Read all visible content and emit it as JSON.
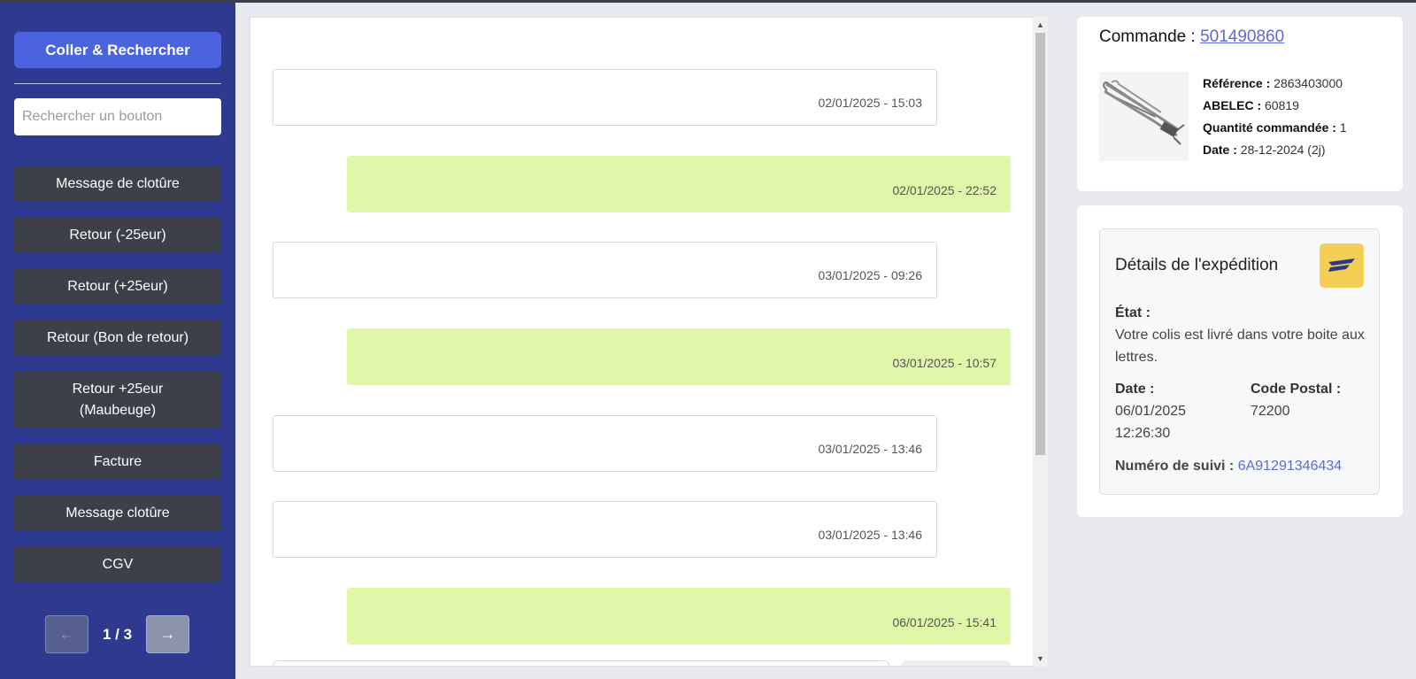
{
  "sidebar": {
    "primary_button": "Coller & Rechercher",
    "search_placeholder": "Rechercher un bouton",
    "buttons": [
      {
        "label": "Message de clotûre"
      },
      {
        "label": "Retour (-25eur)"
      },
      {
        "label": "Retour (+25eur)"
      },
      {
        "label": "Retour (Bon de retour)"
      },
      {
        "label": "Retour +25eur (Maubeuge)"
      },
      {
        "label": "Facture"
      },
      {
        "label": "Message clotûre"
      },
      {
        "label": "CGV"
      }
    ],
    "pager": {
      "prev": "←",
      "label": "1 / 3",
      "next": "→"
    }
  },
  "conversation": {
    "messages": [
      {
        "direction": "in",
        "timestamp": "02/01/2025 - 15:03"
      },
      {
        "direction": "out",
        "timestamp": "02/01/2025 - 22:52"
      },
      {
        "direction": "in",
        "timestamp": "03/01/2025 - 09:26"
      },
      {
        "direction": "out",
        "timestamp": "03/01/2025 - 10:57"
      },
      {
        "direction": "in",
        "timestamp": "03/01/2025 - 13:46"
      },
      {
        "direction": "in",
        "timestamp": "03/01/2025 - 13:46"
      },
      {
        "direction": "out",
        "timestamp": "06/01/2025 - 15:41"
      }
    ]
  },
  "order": {
    "title_label": "Commande :",
    "number": "501490860",
    "reference_label": "Référence :",
    "reference": "2863403000",
    "abelec_label": "ABELEC :",
    "abelec": "60819",
    "quantity_label": "Quantité commandée :",
    "quantity": "1",
    "date_label": "Date :",
    "date": "28-12-2024 (2j)"
  },
  "shipment": {
    "title": "Détails de l'expédition",
    "state_label": "État :",
    "state_text": "Votre colis est livré dans votre boite aux lettres.",
    "date_label": "Date :",
    "date_value": "06/01/2025",
    "time_value": "12:26:30",
    "postal_label": "Code Postal :",
    "postal_value": "72200",
    "tracking_label": "Numéro de suivi :",
    "tracking_value": "6A91291346434"
  },
  "colors": {
    "sidebar": "#2d3a8f",
    "primary": "#4b63de",
    "outgoing_message": "#e0f6a8",
    "carrier_logo": "#f5ce54",
    "link": "#5b6ad8"
  }
}
